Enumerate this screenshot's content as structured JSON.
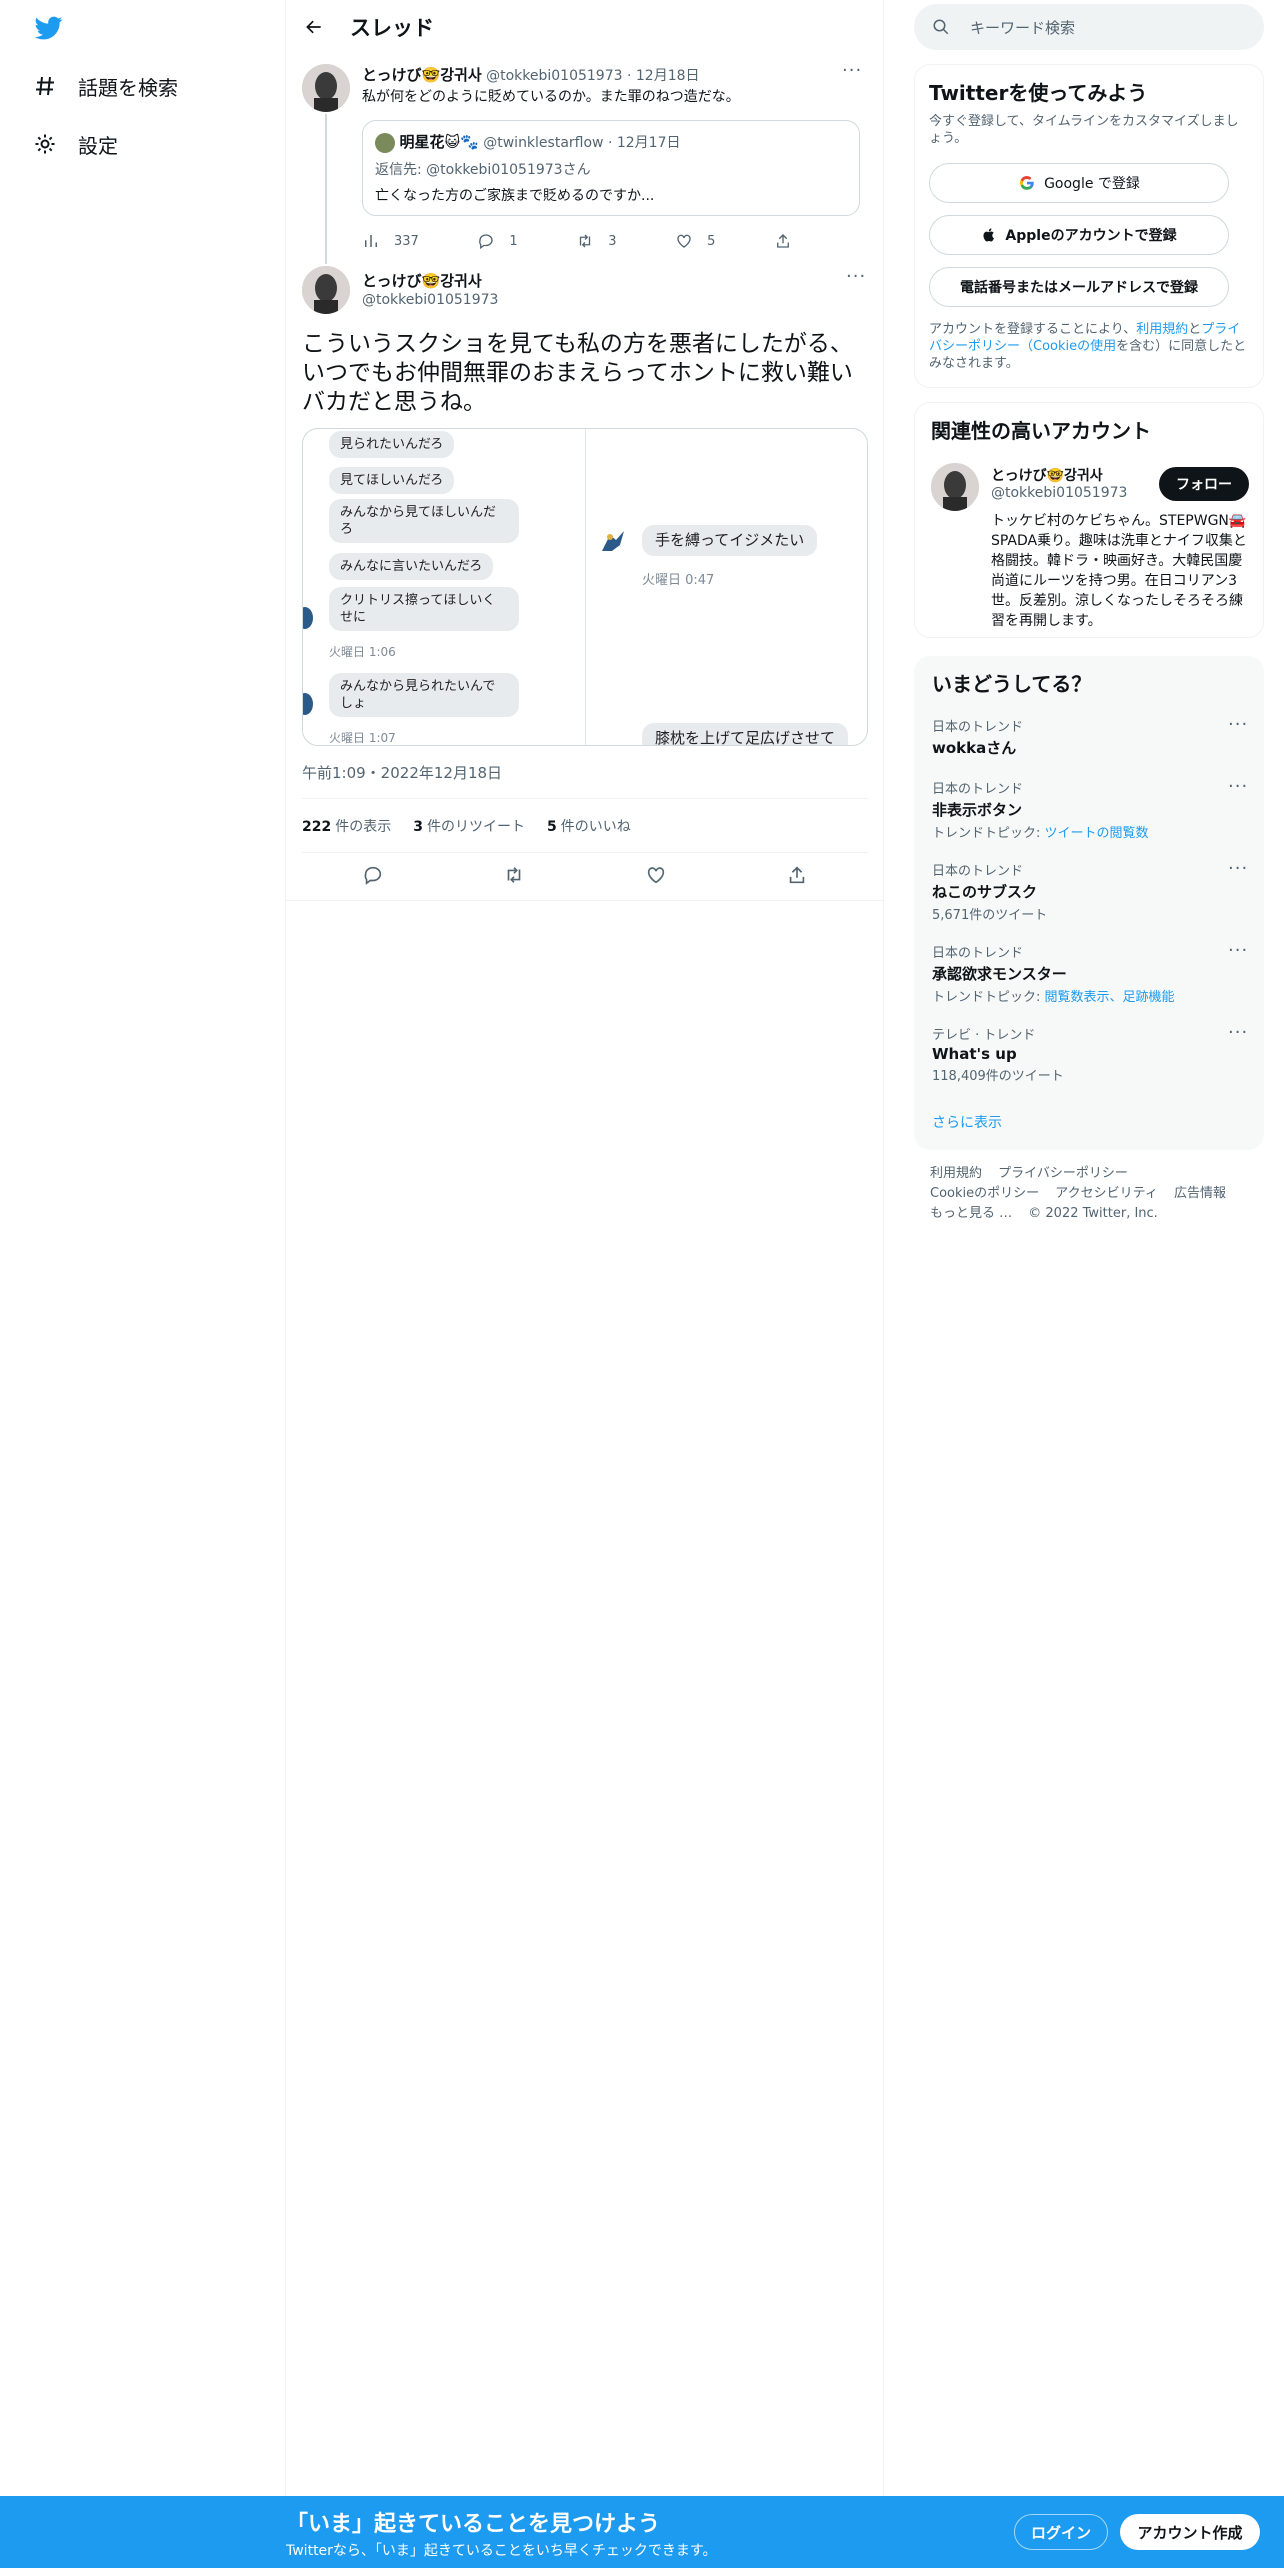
{
  "colors": {
    "accent": "#1d9bf0",
    "text": "#0f1419",
    "muted": "#536471",
    "border": "#eff3f4",
    "banner": "#1d9bf0"
  },
  "nav": {
    "logo_icon": "twitter-bird-icon",
    "items": [
      {
        "icon": "hashtag-icon",
        "label": "話題を検索"
      },
      {
        "icon": "gear-icon",
        "label": "設定"
      }
    ]
  },
  "header": {
    "back_icon": "arrow-left-icon",
    "title": "スレッド"
  },
  "reply_tweet": {
    "name": "とっけび🤓강귀사",
    "handle": "@tokkebi01051973",
    "date": "12月18日",
    "text": "私が何をどのように貶めているのか。また罪のねつ造だな。",
    "quote": {
      "name": "明星花😺🐾",
      "handle": "@twinklestarflow",
      "date": "12月17日",
      "reply_to": "返信先: @tokkebi01051973さん",
      "text": "亡くなった方のご家族まで貶めるのですか..."
    },
    "actions": {
      "views": "337",
      "replies": "1",
      "retweets": "3",
      "likes": "5"
    }
  },
  "main_tweet": {
    "name": "とっけび🤓강귀사",
    "handle": "@tokkebi01051973",
    "text": "こういうスクショを見ても私の方を悪者にしたがる、いつでもお仲間無罪のおまえらってホントに救い難いバカだと思うね。",
    "media_left": {
      "bubbles": [
        "見られたいんだろ",
        "見てほしいんだろ",
        "みんなから見てほしいんだろ",
        "みんなに言いたいんだろ",
        "クリトリス擦ってほしいくせに",
        "みんなから見られたいんでしょ"
      ],
      "times": [
        "火曜日 1:06",
        "火曜日 1:07"
      ]
    },
    "media_right": {
      "bubble": "手を縛ってイジメたい",
      "time": "火曜日 0:47",
      "cut_bubble": "膝枕を上げて足広げさせて"
    },
    "timestamp": "午前1:09・2022年12月18日",
    "stats": [
      {
        "num": "222",
        "label": "件の表示"
      },
      {
        "num": "3",
        "label": "件のリツイート"
      },
      {
        "num": "5",
        "label": "件のいいね"
      }
    ]
  },
  "sidebar": {
    "search_placeholder": "キーワード検索",
    "signup": {
      "title": "Twitterを使ってみよう",
      "subtitle": "今すぐ登録して、タイムラインをカスタマイズしましょう。",
      "google": "Google で登録",
      "apple": "Appleのアカウントで登録",
      "phone": "電話番号またはメールアドレスで登録",
      "legal_1": "アカウントを登録することにより、",
      "legal_link1": "利用規約",
      "legal_2": "と",
      "legal_link2": "プライバシーポリシー（Cookieの使用",
      "legal_3": "を含む）に同意したとみなされます。"
    },
    "related": {
      "title": "関連性の高いアカウント",
      "name": "とっけび🤓강귀사",
      "handle": "@tokkebi01051973",
      "follow": "フォロー",
      "bio": "トッケビ村のケビちゃん。STEPWGN🚘SPADA乗り。趣味は洗車とナイフ収集と格闘技。韓ドラ・映画好き。大韓民国慶尚道にルーツを持つ男。在日コリアン3世。反差別。涼しくなったしそろそろ練習を再開します。"
    },
    "trends": {
      "title": "いまどうしてる？",
      "items": [
        {
          "category": "日本のトレンド",
          "name": "wokkaさん",
          "sub": "",
          "link": ""
        },
        {
          "category": "日本のトレンド",
          "name": "非表示ボタン",
          "sub": "トレンドトピック: ",
          "link": "ツイートの閲覧数"
        },
        {
          "category": "日本のトレンド",
          "name": "ねこのサブスク",
          "sub": "5,671件のツイート",
          "link": ""
        },
        {
          "category": "日本のトレンド",
          "name": "承認欲求モンスター",
          "sub": "トレンドトピック: ",
          "link": "閲覧数表示、足跡機能"
        },
        {
          "category": "テレビ · トレンド",
          "name": "What's up",
          "sub": "118,409件のツイート",
          "link": ""
        }
      ],
      "more": "さらに表示"
    },
    "footer": [
      "利用規約",
      "プライバシーポリシー",
      "Cookieのポリシー",
      "アクセシビリティ",
      "広告情報",
      "もっと見る …",
      "© 2022 Twitter, Inc."
    ]
  },
  "banner": {
    "title": "「いま」起きていることを見つけよう",
    "subtitle": "Twitterなら、「いま」起きていることをいち早くチェックできます。",
    "login": "ログイン",
    "signup": "アカウント作成"
  }
}
